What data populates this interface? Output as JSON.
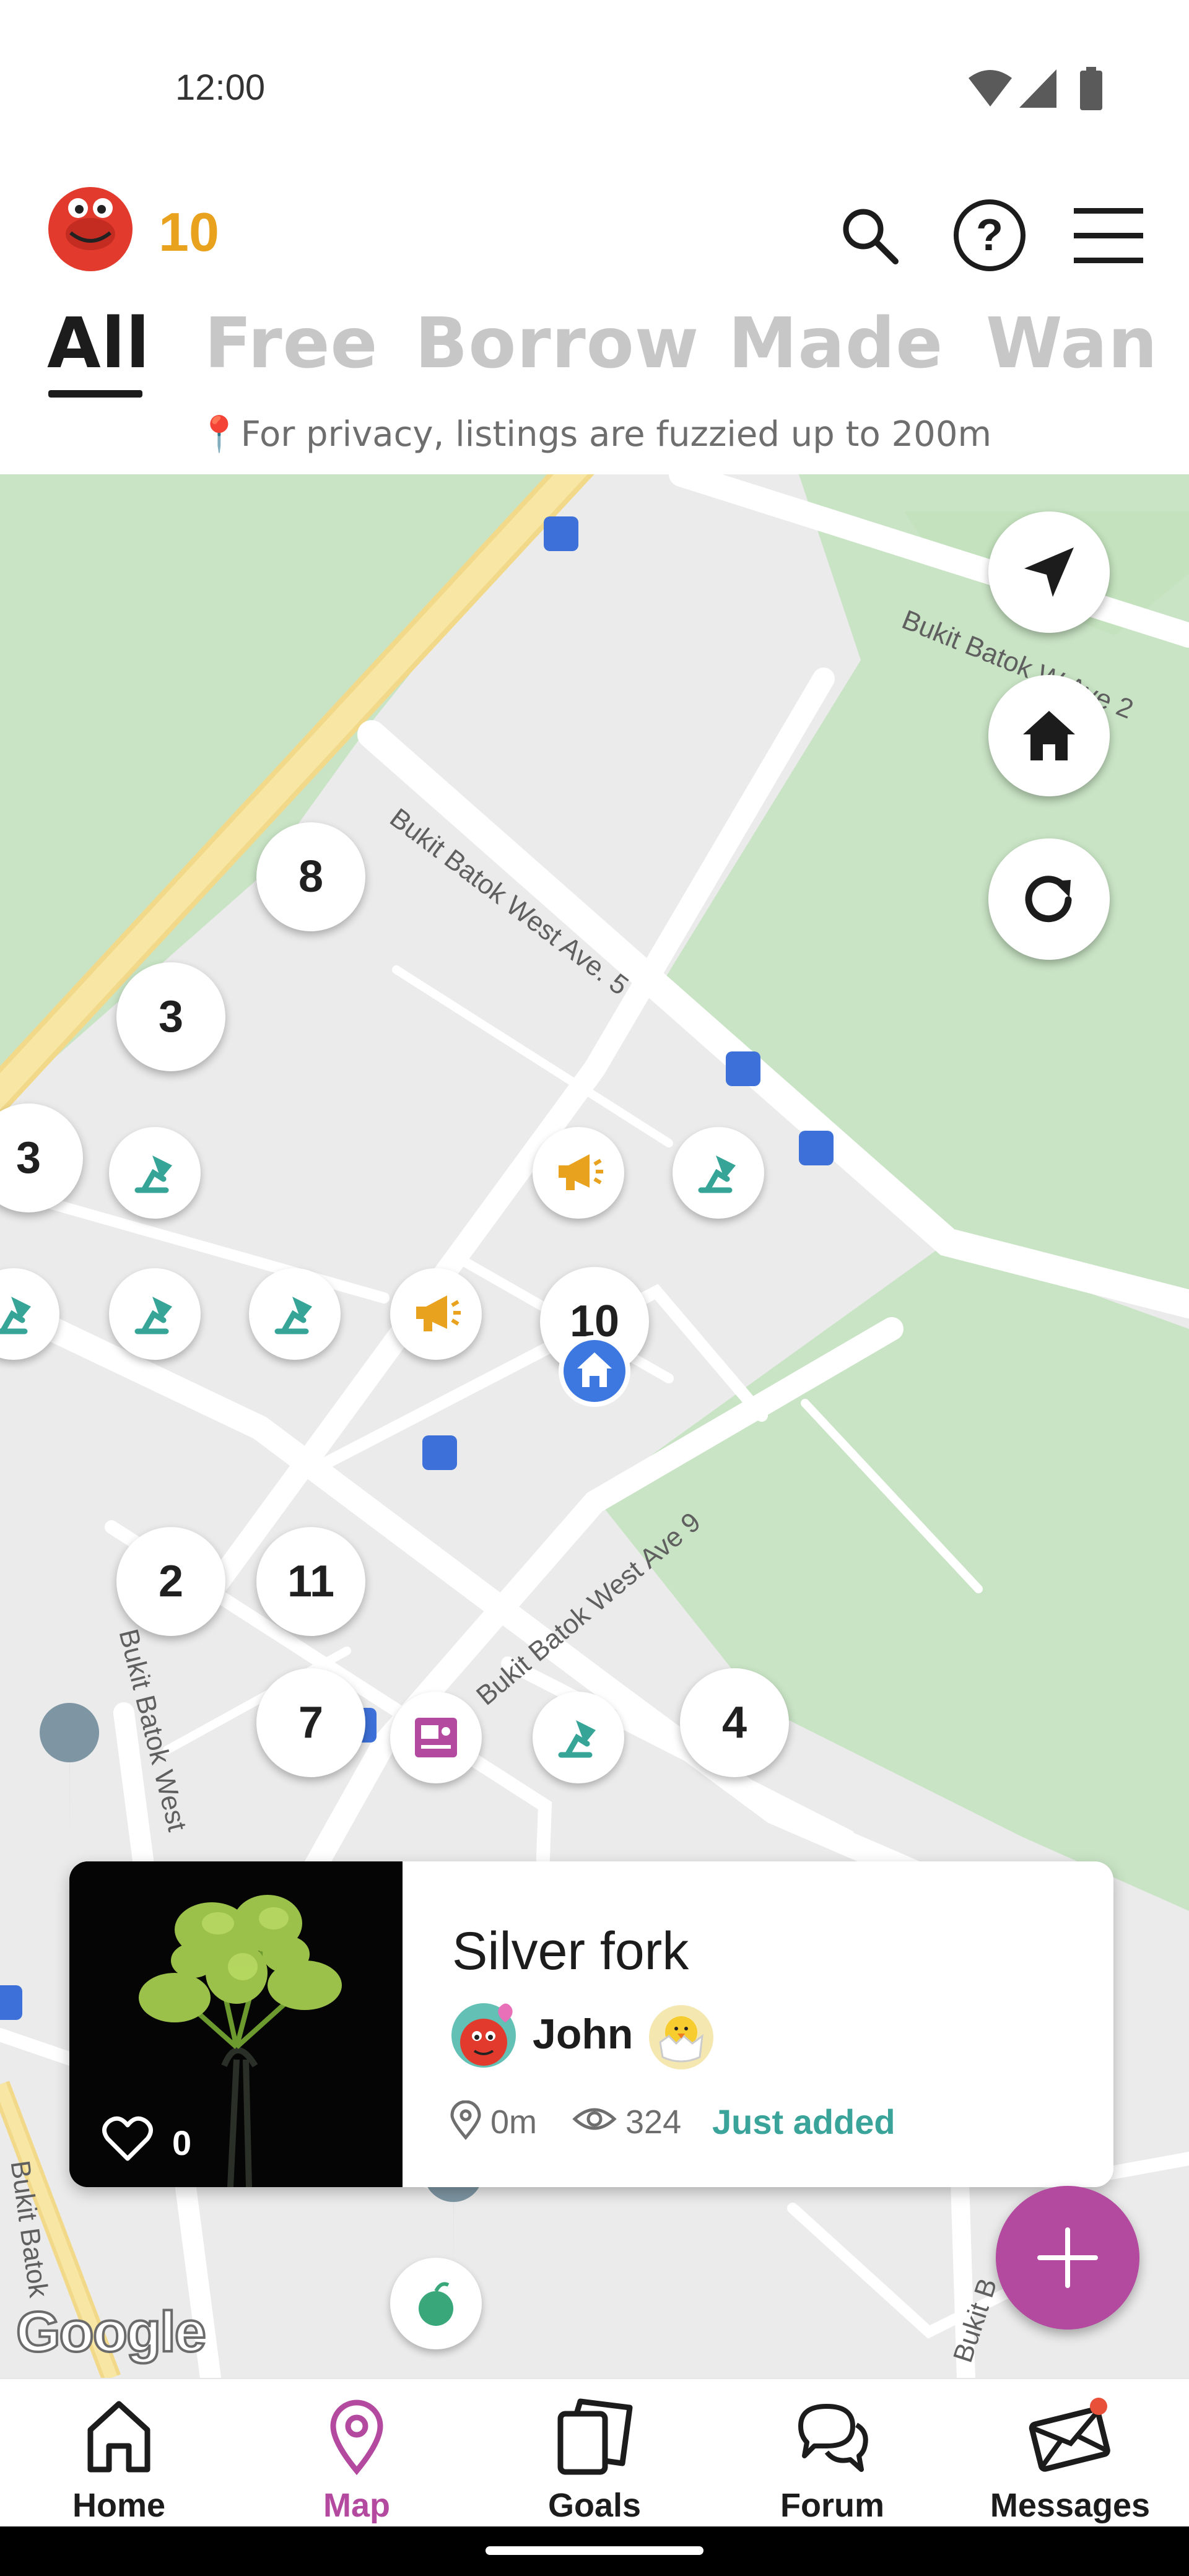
{
  "status_bar": {
    "time": "12:00"
  },
  "header": {
    "coin_count": "10",
    "tabs": [
      "All",
      "Free",
      "Borrow",
      "Made",
      "Wan"
    ],
    "active_tab": "All",
    "privacy_note": "For privacy, listings are fuzzied up to 200m"
  },
  "map": {
    "clusters": [
      "8",
      "3",
      "3",
      "10",
      "2",
      "11",
      "7",
      "4"
    ],
    "road_labels": [
      "Bukit Batok West Ave. 5",
      "Bukit Batok West Ave 9",
      "Bukit Batok West",
      "Bukit Batok W Ave 2",
      "Bukit Batok",
      "Bukit B"
    ],
    "attribution": "Google",
    "colors": {
      "park": "#c9e4c5",
      "road": "#ffffff",
      "highway": "#f7e39a",
      "teal_pin": "#36a597",
      "orange_pin": "#e8a21e",
      "pink_pin": "#b34a9f",
      "green_pin": "#3aa77b"
    }
  },
  "card": {
    "title": "Silver fork",
    "user": "John",
    "likes": "0",
    "distance": "0m",
    "views": "324",
    "added": "Just added"
  },
  "nav": {
    "items": [
      {
        "label": "Home",
        "icon": "home-icon"
      },
      {
        "label": "Map",
        "icon": "map-pin-icon"
      },
      {
        "label": "Goals",
        "icon": "goals-icon"
      },
      {
        "label": "Forum",
        "icon": "forum-icon"
      },
      {
        "label": "Messages",
        "icon": "envelope-icon"
      }
    ],
    "active": "Map",
    "accent": "#b34a9f"
  }
}
